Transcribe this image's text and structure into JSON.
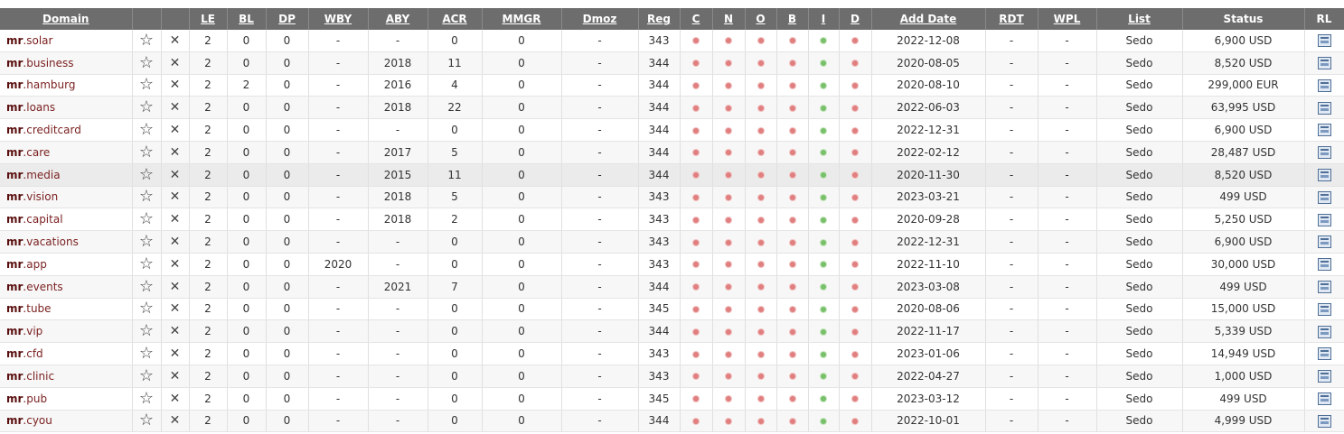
{
  "columns": [
    {
      "key": "domain",
      "label": "Domain",
      "link": true
    },
    {
      "key": "star",
      "label": "",
      "link": false
    },
    {
      "key": "x",
      "label": "",
      "link": false
    },
    {
      "key": "le",
      "label": "LE",
      "link": true
    },
    {
      "key": "bl",
      "label": "BL",
      "link": true
    },
    {
      "key": "dp",
      "label": "DP",
      "link": true
    },
    {
      "key": "wby",
      "label": "WBY",
      "link": true
    },
    {
      "key": "aby",
      "label": "ABY",
      "link": true
    },
    {
      "key": "acr",
      "label": "ACR",
      "link": true
    },
    {
      "key": "mmgr",
      "label": "MMGR",
      "link": true
    },
    {
      "key": "dmoz",
      "label": "Dmoz",
      "link": true
    },
    {
      "key": "reg",
      "label": "Reg",
      "link": true
    },
    {
      "key": "c",
      "label": "C",
      "link": true
    },
    {
      "key": "n",
      "label": "N",
      "link": true
    },
    {
      "key": "o",
      "label": "O",
      "link": true
    },
    {
      "key": "b",
      "label": "B",
      "link": true
    },
    {
      "key": "i",
      "label": "I",
      "link": true
    },
    {
      "key": "d",
      "label": "D",
      "link": true
    },
    {
      "key": "add_date",
      "label": "Add Date",
      "link": true
    },
    {
      "key": "rdt",
      "label": "RDT",
      "link": true
    },
    {
      "key": "wpl",
      "label": "WPL",
      "link": true
    },
    {
      "key": "list",
      "label": "List",
      "link": true
    },
    {
      "key": "status",
      "label": "Status",
      "link": false
    },
    {
      "key": "rl",
      "label": "RL",
      "link": false
    }
  ],
  "icons": {
    "star": "star-outline-icon",
    "remove": "close-x-icon",
    "rl": "related-list-icon",
    "dot_red": "red-dot",
    "dot_green": "green-dot"
  },
  "colors": {
    "header_bg": "#6d6d6d",
    "domain_text": "#7a1f1f",
    "status_text": "#2f8a14",
    "dot_red": "#e07f7f",
    "dot_green": "#79c06a"
  },
  "rows": [
    {
      "name": "mr",
      "tld": ".solar",
      "le": "2",
      "bl": "0",
      "dp": "0",
      "wby": "-",
      "aby": "-",
      "acr": "0",
      "mmgr": "0",
      "dmoz": "-",
      "reg": "343",
      "date": "2022-12-08",
      "rdt": "-",
      "wpl": "-",
      "list": "Sedo",
      "status": "6,900 USD"
    },
    {
      "name": "mr",
      "tld": ".business",
      "le": "2",
      "bl": "0",
      "dp": "0",
      "wby": "-",
      "aby": "2018",
      "acr": "11",
      "mmgr": "0",
      "dmoz": "-",
      "reg": "344",
      "date": "2020-08-05",
      "rdt": "-",
      "wpl": "-",
      "list": "Sedo",
      "status": "8,520 USD"
    },
    {
      "name": "mr",
      "tld": ".hamburg",
      "le": "2",
      "bl": "2",
      "dp": "0",
      "wby": "-",
      "aby": "2016",
      "acr": "4",
      "mmgr": "0",
      "dmoz": "-",
      "reg": "344",
      "date": "2020-08-10",
      "rdt": "-",
      "wpl": "-",
      "list": "Sedo",
      "status": "299,000 EUR"
    },
    {
      "name": "mr",
      "tld": ".loans",
      "le": "2",
      "bl": "0",
      "dp": "0",
      "wby": "-",
      "aby": "2018",
      "acr": "22",
      "mmgr": "0",
      "dmoz": "-",
      "reg": "344",
      "date": "2022-06-03",
      "rdt": "-",
      "wpl": "-",
      "list": "Sedo",
      "status": "63,995 USD"
    },
    {
      "name": "mr",
      "tld": ".creditcard",
      "le": "2",
      "bl": "0",
      "dp": "0",
      "wby": "-",
      "aby": "-",
      "acr": "0",
      "mmgr": "0",
      "dmoz": "-",
      "reg": "344",
      "date": "2022-12-31",
      "rdt": "-",
      "wpl": "-",
      "list": "Sedo",
      "status": "6,900 USD"
    },
    {
      "name": "mr",
      "tld": ".care",
      "le": "2",
      "bl": "0",
      "dp": "0",
      "wby": "-",
      "aby": "2017",
      "acr": "5",
      "mmgr": "0",
      "dmoz": "-",
      "reg": "344",
      "date": "2022-02-12",
      "rdt": "-",
      "wpl": "-",
      "list": "Sedo",
      "status": "28,487 USD"
    },
    {
      "name": "mr",
      "tld": ".media",
      "le": "2",
      "bl": "0",
      "dp": "0",
      "wby": "-",
      "aby": "2015",
      "acr": "11",
      "mmgr": "0",
      "dmoz": "-",
      "reg": "344",
      "date": "2020-11-30",
      "rdt": "-",
      "wpl": "-",
      "list": "Sedo",
      "status": "8,520 USD",
      "highlight": true
    },
    {
      "name": "mr",
      "tld": ".vision",
      "le": "2",
      "bl": "0",
      "dp": "0",
      "wby": "-",
      "aby": "2018",
      "acr": "5",
      "mmgr": "0",
      "dmoz": "-",
      "reg": "343",
      "date": "2023-03-21",
      "rdt": "-",
      "wpl": "-",
      "list": "Sedo",
      "status": "499 USD"
    },
    {
      "name": "mr",
      "tld": ".capital",
      "le": "2",
      "bl": "0",
      "dp": "0",
      "wby": "-",
      "aby": "2018",
      "acr": "2",
      "mmgr": "0",
      "dmoz": "-",
      "reg": "343",
      "date": "2020-09-28",
      "rdt": "-",
      "wpl": "-",
      "list": "Sedo",
      "status": "5,250 USD"
    },
    {
      "name": "mr",
      "tld": ".vacations",
      "le": "2",
      "bl": "0",
      "dp": "0",
      "wby": "-",
      "aby": "-",
      "acr": "0",
      "mmgr": "0",
      "dmoz": "-",
      "reg": "343",
      "date": "2022-12-31",
      "rdt": "-",
      "wpl": "-",
      "list": "Sedo",
      "status": "6,900 USD"
    },
    {
      "name": "mr",
      "tld": ".app",
      "le": "2",
      "bl": "0",
      "dp": "0",
      "wby": "2020",
      "aby": "-",
      "acr": "0",
      "mmgr": "0",
      "dmoz": "-",
      "reg": "343",
      "date": "2022-11-10",
      "rdt": "-",
      "wpl": "-",
      "list": "Sedo",
      "status": "30,000 USD"
    },
    {
      "name": "mr",
      "tld": ".events",
      "le": "2",
      "bl": "0",
      "dp": "0",
      "wby": "-",
      "aby": "2021",
      "acr": "7",
      "mmgr": "0",
      "dmoz": "-",
      "reg": "344",
      "date": "2023-03-08",
      "rdt": "-",
      "wpl": "-",
      "list": "Sedo",
      "status": "499 USD"
    },
    {
      "name": "mr",
      "tld": ".tube",
      "le": "2",
      "bl": "0",
      "dp": "0",
      "wby": "-",
      "aby": "-",
      "acr": "0",
      "mmgr": "0",
      "dmoz": "-",
      "reg": "345",
      "date": "2020-08-06",
      "rdt": "-",
      "wpl": "-",
      "list": "Sedo",
      "status": "15,000 USD"
    },
    {
      "name": "mr",
      "tld": ".vip",
      "le": "2",
      "bl": "0",
      "dp": "0",
      "wby": "-",
      "aby": "-",
      "acr": "0",
      "mmgr": "0",
      "dmoz": "-",
      "reg": "344",
      "date": "2022-11-17",
      "rdt": "-",
      "wpl": "-",
      "list": "Sedo",
      "status": "5,339 USD"
    },
    {
      "name": "mr",
      "tld": ".cfd",
      "le": "2",
      "bl": "0",
      "dp": "0",
      "wby": "-",
      "aby": "-",
      "acr": "0",
      "mmgr": "0",
      "dmoz": "-",
      "reg": "343",
      "date": "2023-01-06",
      "rdt": "-",
      "wpl": "-",
      "list": "Sedo",
      "status": "14,949 USD"
    },
    {
      "name": "mr",
      "tld": ".clinic",
      "le": "2",
      "bl": "0",
      "dp": "0",
      "wby": "-",
      "aby": "-",
      "acr": "0",
      "mmgr": "0",
      "dmoz": "-",
      "reg": "343",
      "date": "2022-04-27",
      "rdt": "-",
      "wpl": "-",
      "list": "Sedo",
      "status": "1,000 USD"
    },
    {
      "name": "mr",
      "tld": ".pub",
      "le": "2",
      "bl": "0",
      "dp": "0",
      "wby": "-",
      "aby": "-",
      "acr": "0",
      "mmgr": "0",
      "dmoz": "-",
      "reg": "345",
      "date": "2023-03-12",
      "rdt": "-",
      "wpl": "-",
      "list": "Sedo",
      "status": "499 USD"
    },
    {
      "name": "mr",
      "tld": ".cyou",
      "le": "2",
      "bl": "0",
      "dp": "0",
      "wby": "-",
      "aby": "-",
      "acr": "0",
      "mmgr": "0",
      "dmoz": "-",
      "reg": "344",
      "date": "2022-10-01",
      "rdt": "-",
      "wpl": "-",
      "list": "Sedo",
      "status": "4,999 USD"
    }
  ]
}
